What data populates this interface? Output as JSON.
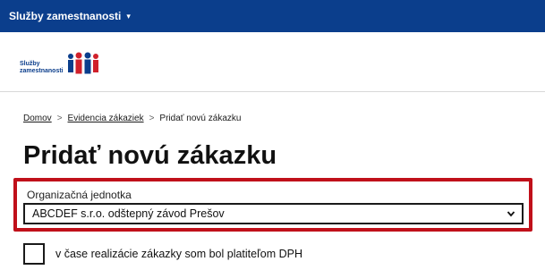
{
  "topbar": {
    "menu_label": "Služby zamestnanosti",
    "caret": "▾"
  },
  "header": {
    "logo_text_line1": "Služby",
    "logo_text_line2": "zamestnanosti",
    "logo_color": "#0b3e8c",
    "logo_accent": "#d0202b"
  },
  "breadcrumb": {
    "items": [
      "Domov",
      "Evidencia zákaziek",
      "Pridať novú zákazku"
    ],
    "separator": ">"
  },
  "page": {
    "title": "Pridať novú zákazku"
  },
  "form": {
    "org_unit_label": "Organizačná jednotka",
    "org_unit_value": "ABCDEF s.r.o. odštepný závod Prešov",
    "vat_checkbox_label": "v čase realizácie zákazky som bol platiteľom DPH",
    "vat_checked": false
  },
  "colors": {
    "topbar": "#0b3e8c",
    "highlight": "#c0101a"
  }
}
